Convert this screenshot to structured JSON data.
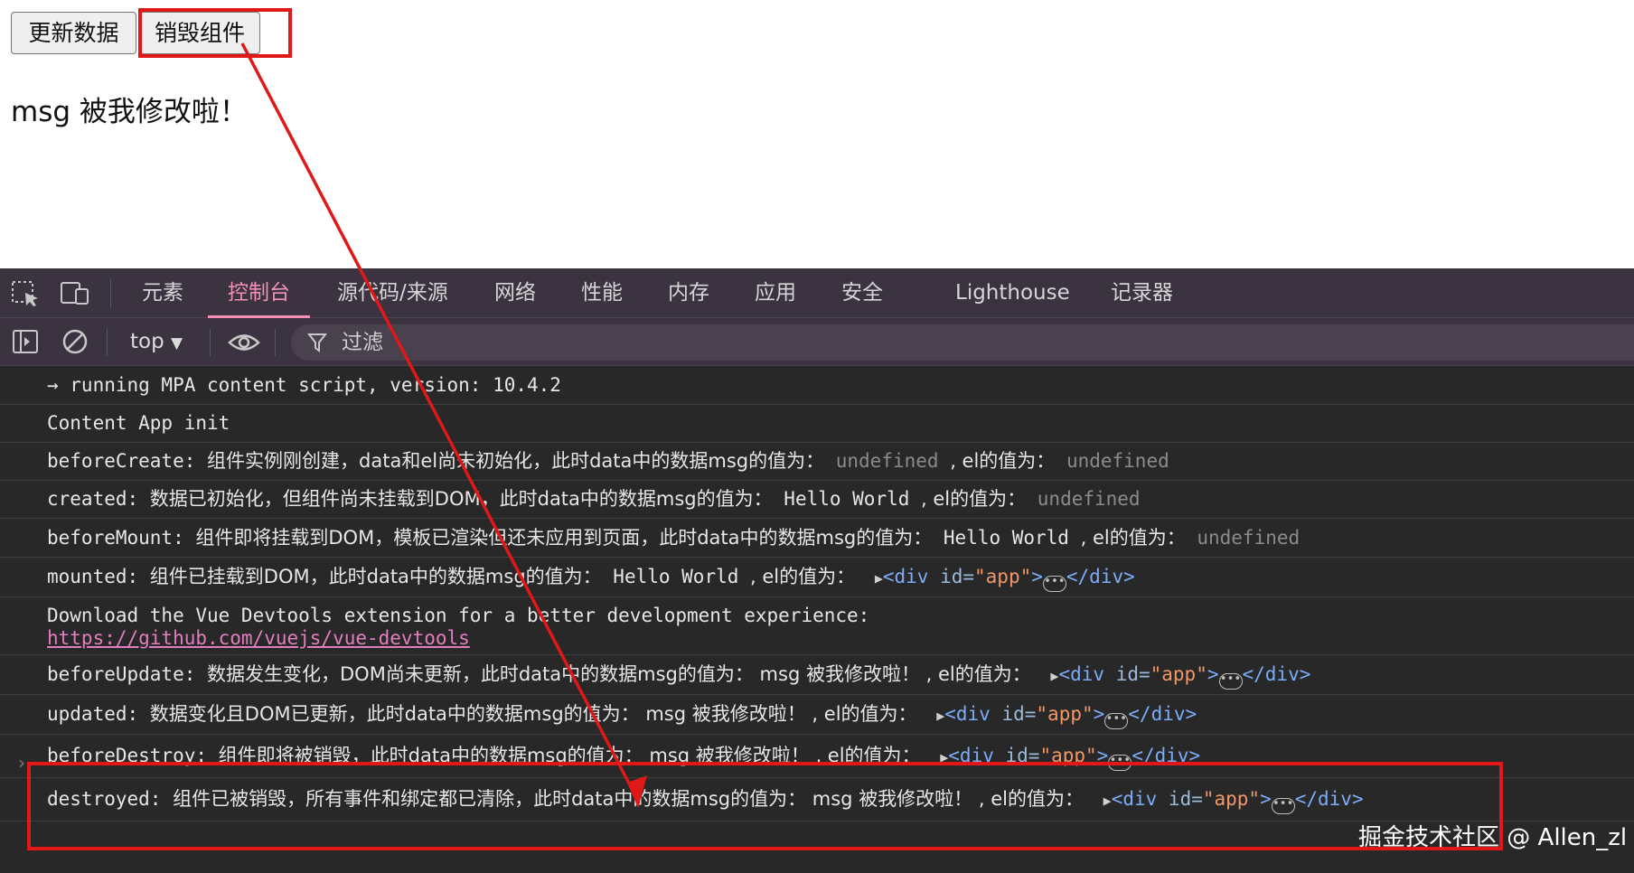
{
  "page": {
    "buttons": {
      "update": "更新数据",
      "destroy": "销毁组件"
    },
    "message": "msg 被我修改啦！"
  },
  "devtools": {
    "tabs": [
      "元素",
      "控制台",
      "源代码/来源",
      "网络",
      "性能",
      "内存",
      "应用",
      "安全",
      "Lighthouse",
      "记录器"
    ],
    "active_tab": "控制台",
    "toolbar": {
      "context": "top",
      "filter_placeholder": "过滤"
    },
    "console": {
      "l1": "→ running MPA content script, version: 10.4.2",
      "l2": "Content App init",
      "l3_a": "beforeCreate: ",
      "l3_b": "组件实例刚创建，data和el尚未初始化，此时data中的数据msg的值为：",
      "l3_c": " undefined ",
      "l3_d": ", el的值为：",
      "l3_e": " undefined",
      "l4_a": "created: ",
      "l4_b": "数据已初始化，但组件尚未挂载到DOM，此时data中的数据msg的值为：",
      "l4_c": " Hello World ",
      "l4_d": ", el的值为：",
      "l4_e": " undefined",
      "l5_a": "beforeMount: ",
      "l5_b": "组件即将挂载到DOM，模板已渲染但还未应用到页面，此时data中的数据msg的值为：",
      "l5_c": " Hello World ",
      "l5_d": ", el的值为：",
      "l5_e": " undefined",
      "l6_a": "mounted: ",
      "l6_b": "组件已挂载到DOM，此时data中的数据msg的值为：",
      "l6_c": " Hello World ",
      "l6_d": ", el的值为：",
      "l7_a": "Download the Vue Devtools extension for a better development experience:",
      "l7_link": "https://github.com/vuejs/vue-devtools",
      "l8_a": "beforeUpdate: ",
      "l8_b": "数据发生变化，DOM尚未更新，此时data中的数据msg的值为：",
      "l8_c": " msg 被我修改啦！ ",
      "l8_d": ", el的值为：",
      "l9_a": "updated: ",
      "l9_b": "数据变化且DOM已更新，此时data中的数据msg的值为：",
      "l9_c": " msg 被我修改啦！ ",
      "l9_d": ", el的值为：",
      "l10_a": "beforeDestroy: ",
      "l10_b": "组件即将被销毁，此时data中的数据msg的值为：",
      "l10_c": " msg 被我修改啦！ ",
      "l10_d": ", el的值为：",
      "l11_a": "destroyed: ",
      "l11_b": "组件已被销毁，所有事件和绑定都已清除，此时data中的数据msg的值为：",
      "l11_c": " msg 被我修改啦！ ",
      "l11_d": ", el的值为：",
      "node_open": "<div",
      "node_attr": " id=",
      "node_val": "\"app\"",
      "node_close": "</div>",
      "node_gt": ">"
    }
  },
  "watermark": "掘金技术社区 @ Allen_zl",
  "colors": {
    "annotation": "#e01818",
    "active_tab": "#f58fb6",
    "devtools_bg": "#282828"
  }
}
